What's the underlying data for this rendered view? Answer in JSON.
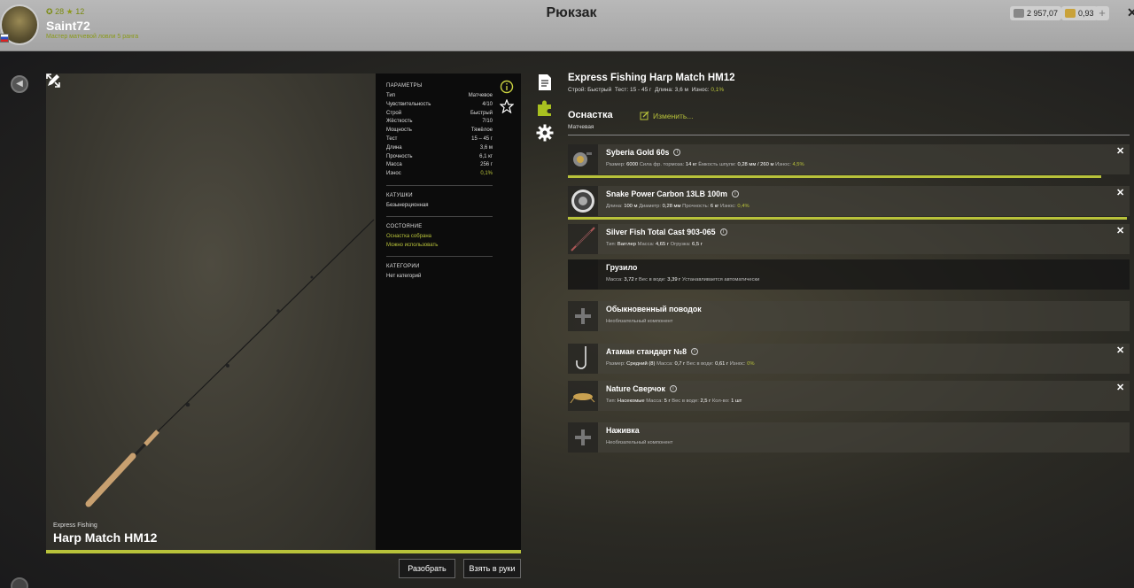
{
  "header": {
    "level": "28",
    "stars": "12",
    "username": "Saint72",
    "rank": "Мастер матчевой ловли 5 ранга",
    "title": "Рюкзак",
    "silver": "2 957,07",
    "gold": "0,93"
  },
  "rod": {
    "brand": "Express Fishing",
    "model": "Harp Match HM12"
  },
  "params": {
    "section_params": "ПАРАМЕТРЫ",
    "rows": [
      {
        "label": "Тип",
        "value": "Матчевое"
      },
      {
        "label": "Чувствительность",
        "value": "4/10"
      },
      {
        "label": "Строй",
        "value": "Быстрый"
      },
      {
        "label": "Жёсткость",
        "value": "7/10"
      },
      {
        "label": "Мощность",
        "value": "Тяжёлое"
      },
      {
        "label": "Тест",
        "value": "15 – 45 г"
      },
      {
        "label": "Длина",
        "value": "3,6 м"
      },
      {
        "label": "Прочность",
        "value": "6,1 кг"
      },
      {
        "label": "Масса",
        "value": "256 г"
      },
      {
        "label": "Износ",
        "value": "0,1%"
      }
    ],
    "section_reels": "КАТУШКИ",
    "reels_value": "Безынерционная",
    "section_state": "СОСТОЯНИЕ",
    "state_1": "Оснастка собрана",
    "state_2": "Можно использовать",
    "section_categories": "КАТЕГОРИИ",
    "categories_value": "Нет категорий"
  },
  "buttons": {
    "disassemble": "Разобрать",
    "take": "Взять в руки"
  },
  "detail": {
    "title": "Express Fishing Harp Match HM12",
    "sub_1": "Строй:",
    "sub_1v": "Быстрый",
    "sub_2": "Тест:",
    "sub_2v": "15 - 45 г",
    "sub_3": "Длина:",
    "sub_3v": "3,6 м",
    "sub_4": "Износ:",
    "sub_4v": "0,1%",
    "section": "Оснастка",
    "section_type": "Матчевая",
    "change": "Изменить..."
  },
  "items": [
    {
      "name": "Syberia Gold 60s",
      "details": [
        [
          "Размер:",
          "6000"
        ],
        [
          "Сила фр. тормоза:",
          "14 кг"
        ],
        [
          "Ёмкость шпули:",
          "0,28 мм / 260 м"
        ],
        [
          "Износ:",
          "4,5%"
        ]
      ],
      "wear": 0.95
    },
    {
      "name": "Snake Power Carbon 13LB 100m",
      "details": [
        [
          "Длина:",
          "100 м"
        ],
        [
          "Диаметр:",
          "0,28 мм"
        ],
        [
          "Прочность:",
          "6 кг"
        ],
        [
          "Износ:",
          "0,4%"
        ]
      ],
      "wear": 0.996
    },
    {
      "name": "Silver Fish Total Cast 903-065",
      "details": [
        [
          "Тип:",
          "Вагглер"
        ],
        [
          "Масса:",
          "4,65 г"
        ],
        [
          "Огрузка:",
          "6,5 г"
        ]
      ]
    },
    {
      "name": "Грузило",
      "details": [
        [
          "Масса:",
          "3,72 г"
        ],
        [
          "Вес в воде:",
          "3,39 г"
        ],
        [
          "Устанавливается автоматически",
          ""
        ]
      ]
    },
    {
      "name": "Обыкновенный поводок",
      "optional": "Необязательный компонент"
    },
    {
      "name": "Атаман стандарт №8",
      "details": [
        [
          "Размер:",
          "Средний (8)"
        ],
        [
          "Масса:",
          "0,7 г"
        ],
        [
          "Вес в воде:",
          "0,61 г"
        ],
        [
          "Износ:",
          "0%"
        ]
      ]
    },
    {
      "name": "Nature Сверчок",
      "details": [
        [
          "Тип:",
          "Насекомые"
        ],
        [
          "Масса:",
          "5 г"
        ],
        [
          "Вес в воде:",
          "2,5 г"
        ],
        [
          "Кол-во:",
          "1 шт"
        ]
      ]
    },
    {
      "name": "Наживка",
      "optional": "Необязательный компонент"
    }
  ],
  "colors": {
    "accent": "#b8c23a"
  }
}
